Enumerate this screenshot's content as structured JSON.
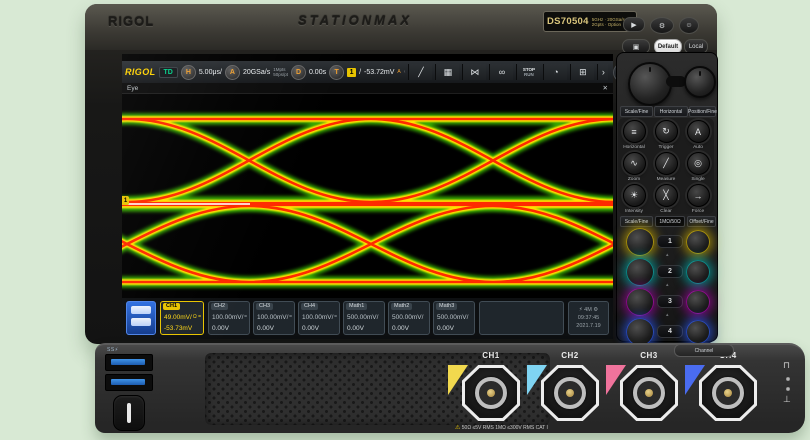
{
  "device": {
    "brand": "RIGOL",
    "series": "STATIONMAX",
    "model": "DS70504",
    "badge_line1": "5GHz · 20GSa/s",
    "badge_line2": "2Gpts · Option"
  },
  "toolbar": {
    "logo": "RIGOL",
    "mode_badge": "TD",
    "h_letter": "H",
    "h_value": "5.00μs/",
    "a_letter": "A",
    "a_value": "20GSa/s",
    "a_detail1": "1Mpts",
    "a_detail2": "50ps/pt",
    "d_letter": "D",
    "d_value": "0.00s",
    "t_letter": "T",
    "t_source": "1",
    "t_slope": "/",
    "t_level": "-53.72mV",
    "t_mode": "A",
    "collapse": "‹",
    "icons": [
      {
        "name": "measure-icon",
        "glyph": "╱"
      },
      {
        "name": "cursors-icon",
        "glyph": "▦"
      },
      {
        "name": "xy-icon",
        "glyph": "⋈"
      },
      {
        "name": "search-icon",
        "glyph": "∞"
      },
      {
        "name": "stop-run-button",
        "line1": "STOP",
        "line2": "RUN"
      },
      {
        "name": "history-icon",
        "glyph": "◔"
      },
      {
        "name": "apps-icon",
        "glyph": "⊞"
      },
      {
        "name": "more-icon",
        "glyph": "›"
      }
    ],
    "gesture_icon": "↻"
  },
  "screen": {
    "tab_title": "Eye",
    "close": "✕",
    "marker": "1"
  },
  "statusbar": {
    "channels": [
      {
        "label": "CH1",
        "scale": "49.00mV/",
        "offset": "-53.73mV",
        "flag": "Ω =",
        "active": true,
        "color": "#e8c400"
      },
      {
        "label": "CH2",
        "scale": "100.00mV/",
        "offset": "0.00V",
        "flag": "="
      },
      {
        "label": "CH3",
        "scale": "100.00mV/",
        "offset": "0.00V",
        "flag": "="
      },
      {
        "label": "CH4",
        "scale": "100.00mV/",
        "offset": "0.00V",
        "flag": "="
      }
    ],
    "math": [
      {
        "label": "Math1",
        "scale": "500.00mV/",
        "offset": "0.00V"
      },
      {
        "label": "Math2",
        "scale": "500.00mV/",
        "offset": "0.00V"
      },
      {
        "label": "Math3",
        "scale": "500.00mV/",
        "offset": "0.00V"
      }
    ],
    "info": {
      "icons": "⚡ 4M ⚙",
      "time": "09:37:45",
      "date": "2021.7.19"
    }
  },
  "right_panel": {
    "top_buttons": [
      {
        "name": "run-control-button",
        "glyph": "▶"
      },
      {
        "name": "settings-button",
        "glyph": "⚙"
      },
      {
        "name": "user-button",
        "glyph": "☺"
      }
    ],
    "quick_buttons": {
      "screenshot_glyph": "▣",
      "default_label": "Default",
      "local_label": "Local"
    },
    "labels_top": [
      "Scale/Fine",
      "Horizontal",
      "Position/Fine"
    ],
    "grid_buttons": [
      {
        "label": "Horizontal",
        "glyph": "≡"
      },
      {
        "label": "Trigger",
        "glyph": "↻"
      },
      {
        "label": "Auto",
        "glyph": "A"
      },
      {
        "label": "Zoom",
        "glyph": "∿"
      },
      {
        "label": "Measure",
        "glyph": "╱"
      },
      {
        "label": "Single",
        "glyph": "◎"
      },
      {
        "label": "Intensity",
        "glyph": "☀"
      },
      {
        "label": "Clear",
        "glyph": "╳"
      },
      {
        "label": "Force",
        "glyph": "→"
      }
    ],
    "labels_bottom": [
      "Scale/Fine",
      "1MΩ/50Ω",
      "Offset/Fine"
    ],
    "channel_rows": [
      {
        "number": "1",
        "color": "#e8c400"
      },
      {
        "number": "2",
        "color": "#00c8c8"
      },
      {
        "number": "3",
        "color": "#cc00cc"
      },
      {
        "number": "4",
        "color": "#2b5cff"
      }
    ],
    "channel_button": "Channel"
  },
  "front_panel": {
    "usb_label": "SS⚡",
    "connectors": [
      {
        "label": "CH1",
        "color": "#f2d94e"
      },
      {
        "label": "CH2",
        "color": "#7fd4f2"
      },
      {
        "label": "CH3",
        "color": "#f0739c"
      },
      {
        "label": "CH4",
        "color": "#4a6cf0"
      }
    ],
    "warning_icon": "⚠",
    "warning": "50Ω ≤5V RMS   1MΩ ≤300V RMS   CAT I",
    "probe_square": "⊓",
    "probe_ground": "⊥"
  }
}
